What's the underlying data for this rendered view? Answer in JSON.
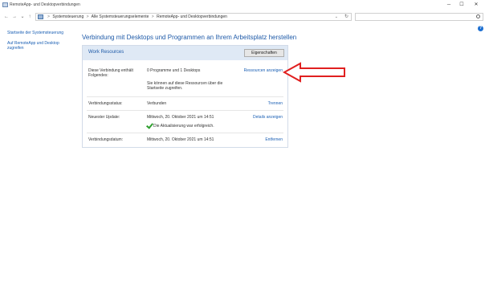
{
  "window": {
    "title": "RemoteApp- und Desktopverbindungen",
    "minimize": "─",
    "maximize": "☐",
    "close": "✕"
  },
  "nav": {
    "back": "←",
    "forward": "→",
    "recent": "⌄",
    "up": "↑"
  },
  "breadcrumb": {
    "items": [
      "Systemsteuerung",
      "Alle Systemsteuerungselemente",
      "RemoteApp- und Desktopverbindungen"
    ],
    "separator": ">"
  },
  "search": {
    "placeholder": ""
  },
  "sidebar": {
    "items": [
      {
        "label": "Startseite der Systemsteuerung"
      },
      {
        "label": "Auf RemoteApp und Desktop zugreifen"
      }
    ]
  },
  "main": {
    "heading": "Verbindung mit Desktops und Programmen an Ihrem Arbeitsplatz herstellen",
    "resource": {
      "title": "Work Resources",
      "properties_button": "Eigenschaften",
      "rows": [
        {
          "label": "Diese Verbindung enthält Folgendes:",
          "value": "0 Programme und 1 Desktops",
          "link": "Ressourcen anzeigen"
        },
        {
          "label": "",
          "value": "Sie können auf diese Ressourcen über die Startseite zugreifen.",
          "link": ""
        },
        {
          "label": "Verbindungsstatus:",
          "value": "Verbunden",
          "link": "Trennen"
        },
        {
          "label": "Neuester Update:",
          "value": "Mittwoch, 20. Oktober 2021 um 14:51",
          "link": "Details anzeigen"
        },
        {
          "label": "",
          "value": "Die Aktualisierung war erfolgreich.",
          "link": ""
        },
        {
          "label": "Verbindungsdatum:",
          "value": "Mittwoch, 20. Oktober 2021 um 14:51",
          "link": "Entfernen"
        }
      ]
    }
  },
  "colors": {
    "accent": "#1e5aa8",
    "link": "#1a5fb4",
    "panel_header": "#dfe9f5",
    "annotation_arrow": "#e02020",
    "success": "#2e9e2e"
  },
  "icons": [
    "app-icon",
    "control-panel-icon",
    "back-arrow-icon",
    "forward-arrow-icon",
    "up-arrow-icon",
    "refresh-icon",
    "search-icon",
    "help-icon",
    "check-icon",
    "annotation-arrow-icon"
  ]
}
